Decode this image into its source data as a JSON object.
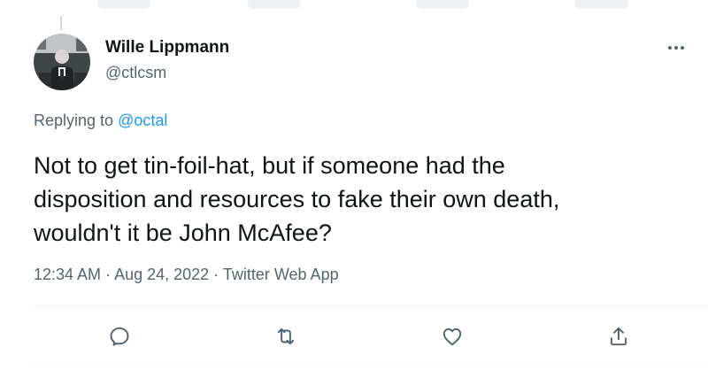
{
  "author": {
    "name": "Wille Lippmann",
    "handle": "@ctlcsm",
    "avatar_icon": "profile-photo"
  },
  "reply_context": {
    "prefix": "Replying to ",
    "target": "@octal"
  },
  "tweet": {
    "text": "Not to get tin-foil-hat, but if someone had the\ndisposition and resources to fake their own death,\nwouldn't it be John McAfee?"
  },
  "meta": {
    "time": "12:34 AM",
    "separator": " · ",
    "date": "Aug 24, 2022",
    "source": "Twitter Web App"
  },
  "actions": [
    {
      "name": "reply",
      "icon": "reply-icon"
    },
    {
      "name": "retweet",
      "icon": "retweet-icon"
    },
    {
      "name": "like",
      "icon": "heart-icon"
    },
    {
      "name": "share",
      "icon": "share-icon"
    }
  ],
  "colors": {
    "text_primary": "#0f1419",
    "text_secondary": "#536471",
    "accent": "#1d9bf0",
    "divider": "#eff3f4"
  }
}
